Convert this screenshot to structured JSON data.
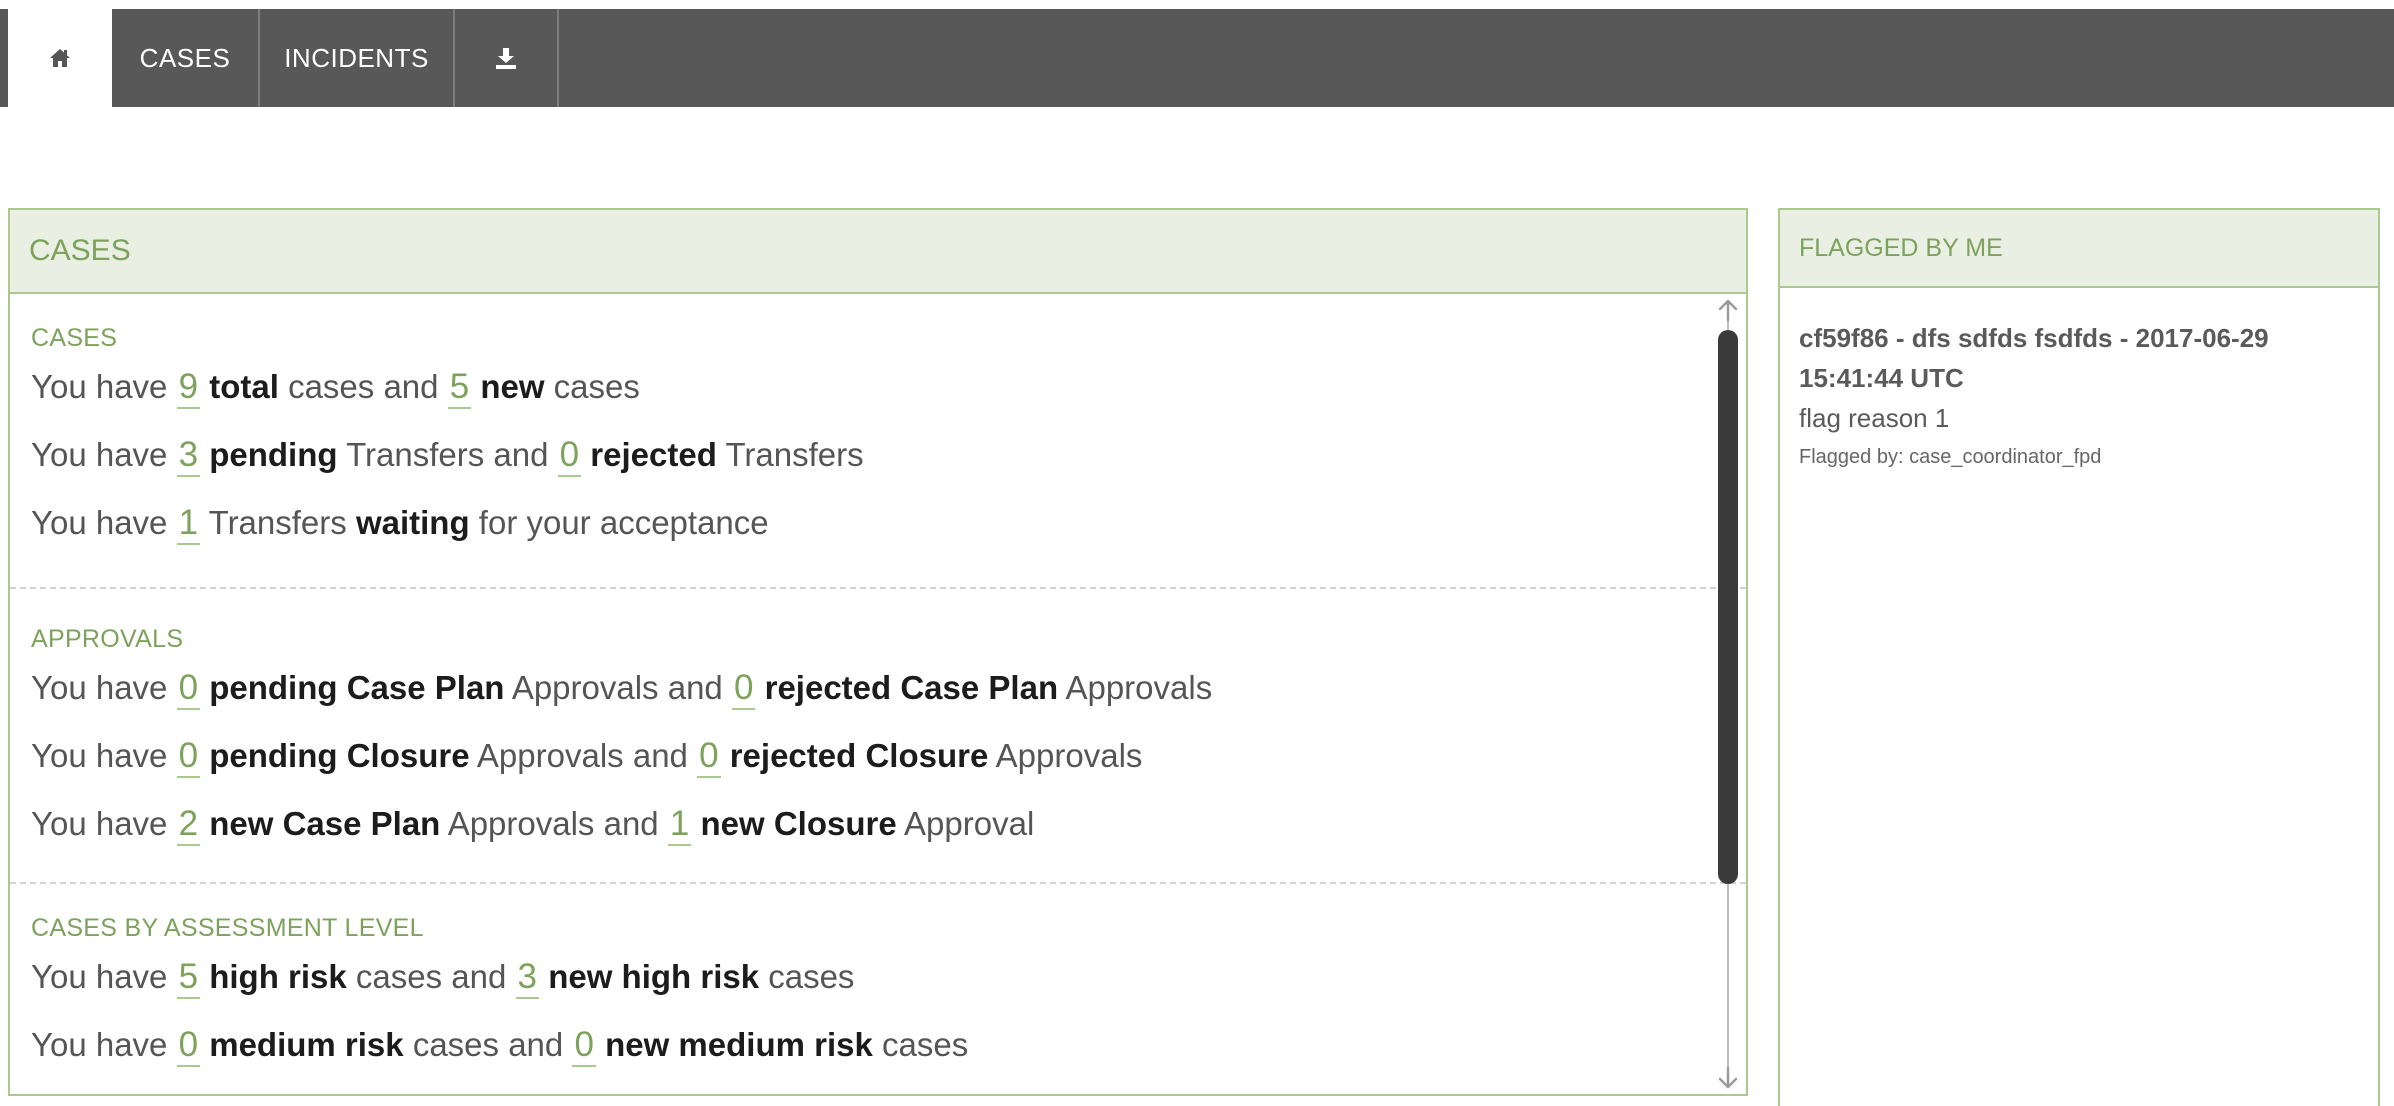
{
  "nav": {
    "home_icon": "home-icon",
    "cases_label": "CASES",
    "incidents_label": "INCIDENTS",
    "download_icon": "download-icon"
  },
  "colors": {
    "accent": "#7da25c",
    "nav_bg": "#585858",
    "panel_border": "#a9c98e",
    "header_bg": "#e9efe3"
  },
  "cases_panel": {
    "title": "CASES",
    "cases": {
      "title": "CASES",
      "line1": {
        "a": "You have ",
        "n1": "9",
        "b1": "total",
        "c": " cases and ",
        "n2": "5",
        "b2": "new",
        "d": " cases"
      },
      "line2": {
        "a": "You have ",
        "n1": "3",
        "b1": "pending",
        "c": " Transfers and ",
        "n2": "0",
        "b2": "rejected",
        "d": " Transfers"
      },
      "line3": {
        "a": "You have ",
        "n1": "1",
        "c": " Transfers ",
        "b1": "waiting",
        "d": " for your acceptance"
      }
    },
    "approvals": {
      "title": "APPROVALS",
      "line1": {
        "a": "You have ",
        "n1": "0",
        "b1": "pending Case Plan",
        "c": " Approvals and ",
        "n2": "0",
        "b2": "rejected Case Plan",
        "d": " Approvals"
      },
      "line2": {
        "a": "You have ",
        "n1": "0",
        "b1": "pending Closure",
        "c": " Approvals and ",
        "n2": "0",
        "b2": "rejected Closure",
        "d": " Approvals"
      },
      "line3": {
        "a": "You have ",
        "n1": "2",
        "b1": "new Case Plan",
        "c": " Approvals and ",
        "n2": "1",
        "b2": "new Closure",
        "d": " Approval"
      }
    },
    "assessment": {
      "title": "CASES BY ASSESSMENT LEVEL",
      "line1": {
        "a": "You have ",
        "n1": "5",
        "b1": "high risk",
        "c": " cases and ",
        "n2": "3",
        "b2": "new high risk",
        "d": " cases"
      },
      "line2": {
        "a": "You have ",
        "n1": "0",
        "b1": "medium risk",
        "c": " cases and ",
        "n2": "0",
        "b2": "new medium risk",
        "d": " cases"
      }
    }
  },
  "flagged_panel": {
    "title": "FLAGGED BY ME",
    "items": [
      {
        "title": "cf59f86 - dfs sdfds fsdfds - 2017-06-29 15:41:44 UTC",
        "reason": "flag reason 1",
        "flagged_by": "Flagged by: case_coordinator_fpd"
      }
    ]
  }
}
